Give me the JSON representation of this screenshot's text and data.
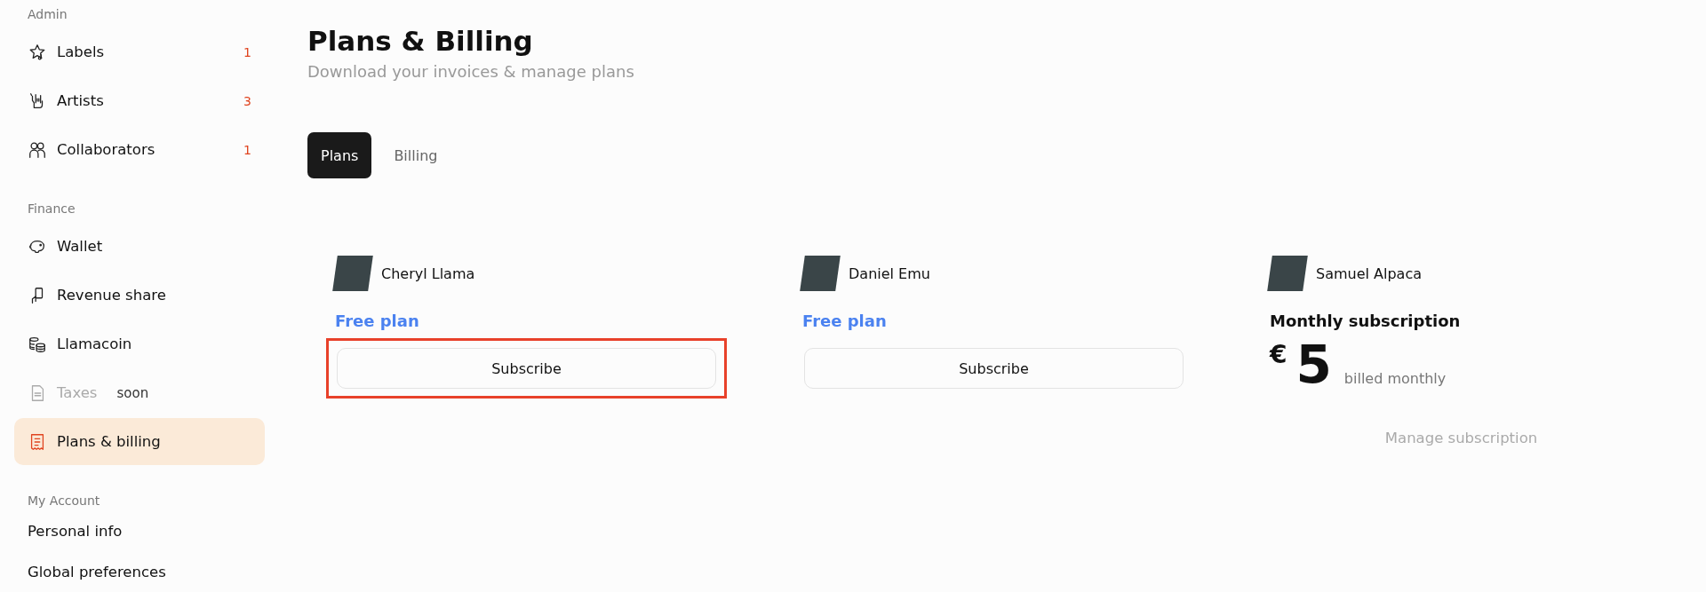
{
  "sidebar": {
    "sections": [
      {
        "title": "Admin",
        "items": [
          {
            "label": "Labels",
            "badge": "1",
            "selected": false,
            "disabled": false
          },
          {
            "label": "Artists",
            "badge": "3",
            "selected": false,
            "disabled": false
          },
          {
            "label": "Collaborators",
            "badge": "1",
            "selected": false,
            "disabled": false
          }
        ]
      },
      {
        "title": "Finance",
        "items": [
          {
            "label": "Wallet",
            "selected": false,
            "disabled": false
          },
          {
            "label": "Revenue share",
            "selected": false,
            "disabled": false
          },
          {
            "label": "Llamacoin",
            "selected": false,
            "disabled": false
          },
          {
            "label": "Taxes",
            "tag": "soon",
            "selected": false,
            "disabled": true
          },
          {
            "label": "Plans & billing",
            "selected": true,
            "disabled": false
          }
        ]
      },
      {
        "title": "My Account",
        "items": [
          {
            "label": "Personal info",
            "selected": false,
            "disabled": false
          },
          {
            "label": "Global preferences",
            "selected": false,
            "disabled": false
          }
        ]
      }
    ]
  },
  "header": {
    "title": "Plans & Billing",
    "subtitle": "Download your invoices & manage plans"
  },
  "tabs": [
    {
      "label": "Plans",
      "selected": true
    },
    {
      "label": "Billing",
      "selected": false
    }
  ],
  "plans": [
    {
      "kind": "free",
      "artist": "Cheryl Llama",
      "plan": "Free plan",
      "button": "Subscribe",
      "highlighted": true
    },
    {
      "kind": "free",
      "artist": "Daniel Emu",
      "plan": "Free plan",
      "button": "Subscribe",
      "highlighted": false
    },
    {
      "kind": "paid",
      "artist": "Samuel Alpaca",
      "plan": "Monthly subscription",
      "currency": "€",
      "amount": "5",
      "period": "billed monthly",
      "link": "Manage subscription",
      "highlighted": false
    }
  ]
}
